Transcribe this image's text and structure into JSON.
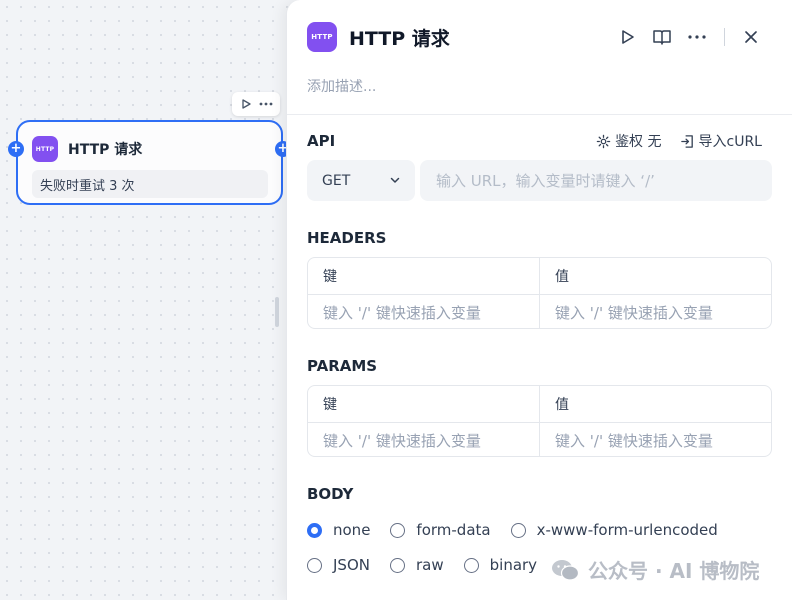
{
  "node": {
    "badge": "HTTP",
    "title": "HTTP 请求",
    "retry_text": "失败时重试 3 次"
  },
  "panel": {
    "badge": "HTTP",
    "title": "HTTP 请求",
    "description_placeholder": "添加描述...",
    "api": {
      "title": "API",
      "auth_label": "鉴权 无",
      "import_label": "导入cURL",
      "method": "GET",
      "url_placeholder": "输入 URL，输入变量时请键入 ‘/’"
    },
    "headers": {
      "title": "HEADERS",
      "key_header": "键",
      "value_header": "值",
      "key_placeholder": "键入 '/' 键快速插入变量",
      "value_placeholder": "键入 '/' 键快速插入变量"
    },
    "params": {
      "title": "PARAMS",
      "key_header": "键",
      "value_header": "值",
      "key_placeholder": "键入 '/' 键快速插入变量",
      "value_placeholder": "键入 '/' 键快速插入变量"
    },
    "body": {
      "title": "BODY",
      "options": [
        "none",
        "form-data",
        "x-www-form-urlencoded",
        "JSON",
        "raw",
        "binary"
      ],
      "selected": "none"
    }
  },
  "watermark": "公众号 · AI 博物院",
  "colors": {
    "accent": "#2e6ef5",
    "badge": "#8250f0"
  },
  "icons": [
    "play-icon",
    "more-icon",
    "book-icon",
    "close-icon",
    "gear-icon",
    "import-icon",
    "chevron-down-icon",
    "wechat-icon"
  ]
}
